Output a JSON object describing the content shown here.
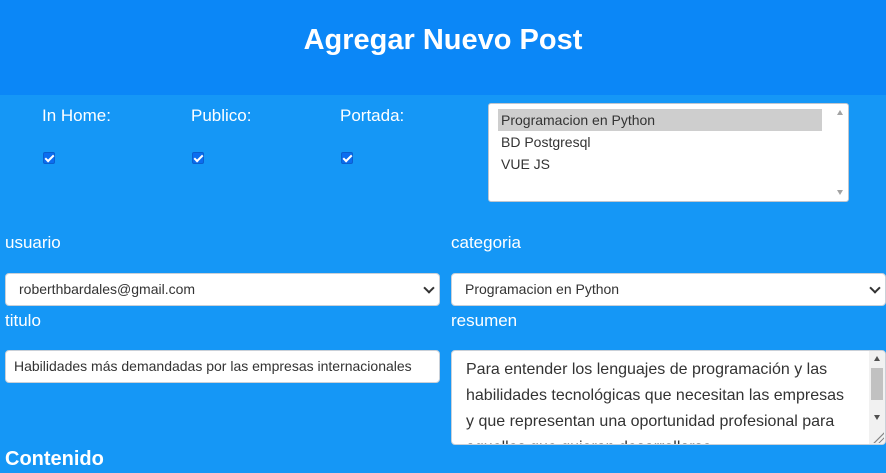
{
  "header": {
    "title": "Agregar Nuevo Post"
  },
  "flags": [
    {
      "label": "In Home:",
      "checked": true
    },
    {
      "label": "Publico:",
      "checked": true
    },
    {
      "label": "Portada:",
      "checked": true
    }
  ],
  "tag_list": {
    "options": [
      "Programacion en Python",
      "BD Postgresql",
      "VUE JS"
    ],
    "selected_index": 0
  },
  "form": {
    "usuario_label": "usuario",
    "usuario_value": "roberthbardales@gmail.com",
    "categoria_label": "categoria",
    "categoria_value": "Programacion en Python",
    "titulo_label": "titulo",
    "titulo_value": "Habilidades más demandadas por las empresas internacionales",
    "resumen_label": "resumen",
    "resumen_value": "Para entender los lenguajes de programación y las habilidades tecnológicas que necesitan las empresas y que representan una oportunidad profesional para aquellos que quieran desarrollarse",
    "contenido_label": "Contenido"
  },
  "colors": {
    "header_bg": "#0b87f7",
    "page_bg": "#1597f6",
    "checkbox_accent": "#0b6df0"
  },
  "icons": {
    "select_arrow": "chevron-down-icon",
    "checkbox_mark": "check-icon"
  }
}
